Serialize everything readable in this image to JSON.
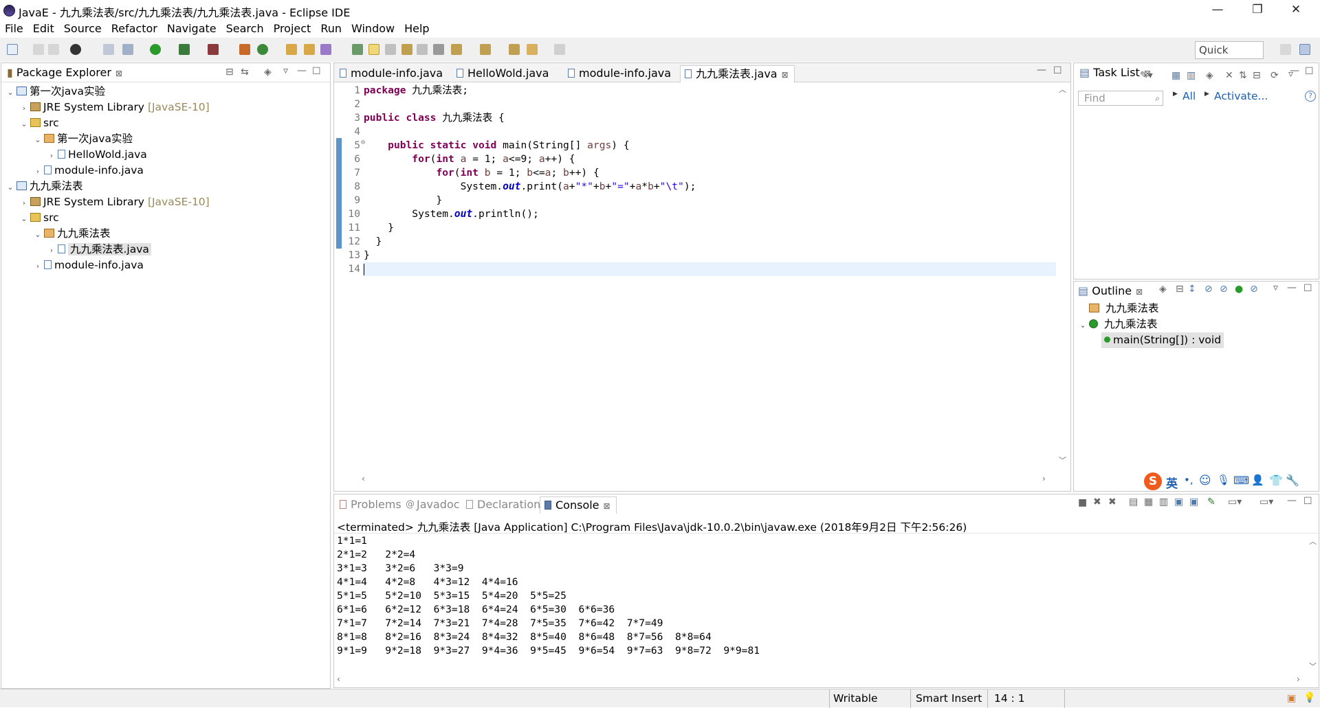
{
  "window": {
    "title": "JavaE - 九九乘法表/src/九九乘法表/九九乘法表.java - Eclipse IDE",
    "minimize": "—",
    "restore": "❐",
    "close": "✕"
  },
  "menu": [
    "File",
    "Edit",
    "Source",
    "Refactor",
    "Navigate",
    "Search",
    "Project",
    "Run",
    "Window",
    "Help"
  ],
  "toolbar": {
    "quick_access": "Quick Access"
  },
  "package_explorer": {
    "title": "Package Explorer",
    "close": "⊠",
    "tree": [
      {
        "label": "第一次java实验",
        "suffix": "",
        "depth": 0,
        "twisty": "⌄",
        "icon": "project-icon"
      },
      {
        "label": "JRE System Library",
        "suffix": "[JavaSE-10]",
        "depth": 1,
        "twisty": "›",
        "icon": "library-icon"
      },
      {
        "label": "src",
        "suffix": "",
        "depth": 1,
        "twisty": "⌄",
        "icon": "source-folder-icon"
      },
      {
        "label": "第一次java实验",
        "suffix": "",
        "depth": 2,
        "twisty": "⌄",
        "icon": "package-icon"
      },
      {
        "label": "HelloWold.java",
        "suffix": "",
        "depth": 3,
        "twisty": "›",
        "icon": "java-file-icon"
      },
      {
        "label": "module-info.java",
        "suffix": "",
        "depth": 2,
        "twisty": "›",
        "icon": "java-file-icon"
      },
      {
        "label": "九九乘法表",
        "suffix": "",
        "depth": 0,
        "twisty": "⌄",
        "icon": "project-icon"
      },
      {
        "label": "JRE System Library",
        "suffix": "[JavaSE-10]",
        "depth": 1,
        "twisty": "›",
        "icon": "library-icon"
      },
      {
        "label": "src",
        "suffix": "",
        "depth": 1,
        "twisty": "⌄",
        "icon": "source-folder-icon"
      },
      {
        "label": "九九乘法表",
        "suffix": "",
        "depth": 2,
        "twisty": "⌄",
        "icon": "package-icon"
      },
      {
        "label": "九九乘法表.java",
        "suffix": "",
        "depth": 3,
        "twisty": "›",
        "icon": "java-file-icon",
        "selected": true
      },
      {
        "label": "module-info.java",
        "suffix": "",
        "depth": 2,
        "twisty": "›",
        "icon": "java-file-icon"
      }
    ]
  },
  "editor": {
    "tabs": [
      {
        "label": "module-info.java"
      },
      {
        "label": "HelloWold.java"
      },
      {
        "label": "module-info.java"
      },
      {
        "label": "九九乘法表.java",
        "active": true,
        "close": "⊠"
      }
    ],
    "line_numbers": [
      "1",
      "2",
      "3",
      "4",
      "5",
      "6",
      "7",
      "8",
      "9",
      "10",
      "11",
      "12",
      "13",
      "14"
    ],
    "fold_marker": "⊖",
    "cursor_line": "14"
  },
  "task_list": {
    "title": "Task List",
    "find_placeholder": "Find",
    "all": "All",
    "activate": "Activate...",
    "help": "?"
  },
  "outline": {
    "title": "Outline",
    "items": [
      {
        "label": "九九乘法表",
        "icon": "package-icon"
      },
      {
        "label": "九九乘法表",
        "icon": "class-icon",
        "twisty": "⌄"
      },
      {
        "label": "main(String[]) : void",
        "icon": "method-icon",
        "selected": true
      }
    ]
  },
  "bottom_tabs": [
    {
      "label": "Problems"
    },
    {
      "label": "Javadoc"
    },
    {
      "label": "Declaration"
    },
    {
      "label": "Console",
      "active": true,
      "close": "⊠"
    }
  ],
  "console": {
    "header": "<terminated> 九九乘法表 [Java Application] C:\\Program Files\\Java\\jdk-10.0.2\\bin\\javaw.exe (2018年9月2日 下午2:56:26)",
    "lines": [
      "1*1=1",
      "2*1=2   2*2=4",
      "3*1=3   3*2=6   3*3=9",
      "4*1=4   4*2=8   4*3=12  4*4=16",
      "5*1=5   5*2=10  5*3=15  5*4=20  5*5=25",
      "6*1=6   6*2=12  6*3=18  6*4=24  6*5=30  6*6=36",
      "7*1=7   7*2=14  7*3=21  7*4=28  7*5=35  7*6=42  7*7=49",
      "8*1=8   8*2=16  8*3=24  8*4=32  8*5=40  8*6=48  8*7=56  8*8=64",
      "9*1=9   9*2=18  9*3=27  9*4=36  9*5=45  9*6=54  9*7=63  9*8=72  9*9=81"
    ]
  },
  "ime": {
    "lang": "英"
  },
  "status_bar": {
    "writable": "Writable",
    "insert_mode": "Smart Insert",
    "position": "14 : 1"
  }
}
